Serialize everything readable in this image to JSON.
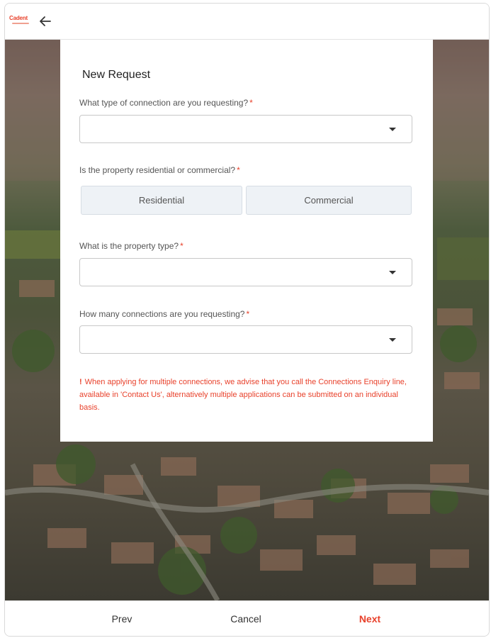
{
  "header": {
    "logo_text": "Cadent",
    "back_icon": "arrow-left-icon"
  },
  "form": {
    "title": "New Request",
    "q1": {
      "label": "What type of connection are you requesting?",
      "required": "*",
      "value": ""
    },
    "q2": {
      "label": "Is the property residential or commercial?",
      "required": "*",
      "options": [
        "Residential",
        "Commercial"
      ]
    },
    "q3": {
      "label": "What is the property type?",
      "required": "*",
      "value": ""
    },
    "q4": {
      "label": "How many connections are you requesting?",
      "required": "*",
      "value": ""
    },
    "warning": {
      "icon": "!",
      "text": "When applying for multiple connections, we advise that you call the Connections Enquiry line, available in 'Contact Us', alternatively multiple applications can be submitted on an individual basis."
    }
  },
  "footer": {
    "prev_label": "Prev",
    "cancel_label": "Cancel",
    "next_label": "Next"
  },
  "colors": {
    "accent": "#e8412b",
    "toggle_bg": "#eef2f6",
    "border": "#c8c8c8"
  }
}
